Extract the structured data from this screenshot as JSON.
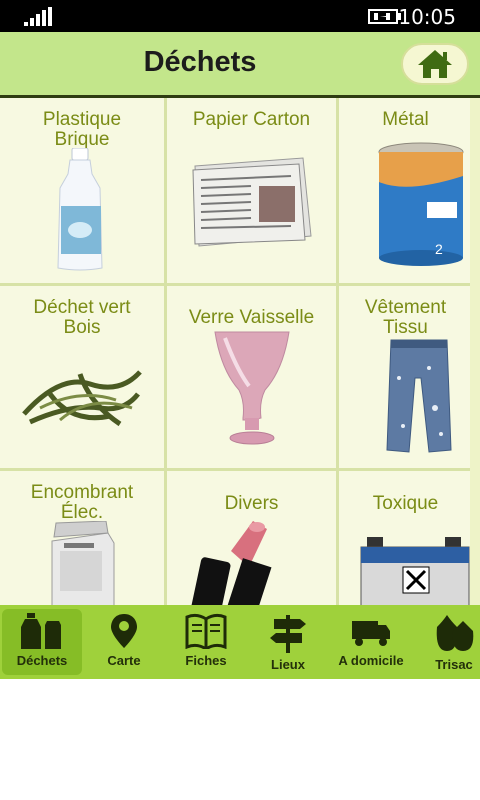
{
  "status": {
    "time": "10:05"
  },
  "header": {
    "title": "Déchets",
    "home_icon": "house-icon"
  },
  "tiles": [
    {
      "label": "Plastique\nBrique",
      "icon": "milk-bottle-icon"
    },
    {
      "label": "Papier Carton",
      "icon": "newspaper-icon"
    },
    {
      "label": "Métal",
      "icon": "tin-can-icon"
    },
    {
      "label": "Déchet vert\nBois",
      "icon": "green-leaves-icon"
    },
    {
      "label": "Verre Vaisselle",
      "icon": "glass-vase-icon"
    },
    {
      "label": "Vêtement\nTissu",
      "icon": "jeans-icon"
    },
    {
      "label": "Encombrant\nÉlec.",
      "icon": "washing-machine-icon"
    },
    {
      "label": "Divers",
      "icon": "lipstick-icon"
    },
    {
      "label": "Toxique",
      "icon": "battery-icon"
    }
  ],
  "nav": [
    {
      "label": "Déchets",
      "icon": "bottles-icon"
    },
    {
      "label": "Carte",
      "icon": "map-pin-icon"
    },
    {
      "label": "Fiches",
      "icon": "book-icon"
    },
    {
      "label": "Lieux",
      "icon": "signpost-icon"
    },
    {
      "label": "A domicile",
      "icon": "truck-icon"
    },
    {
      "label": "Trisac",
      "icon": "bags-icon"
    }
  ],
  "colors": {
    "accent": "#9fd13b",
    "header": "#c3e68b",
    "label": "#7b8c16",
    "tile": "#f7f9e1"
  }
}
